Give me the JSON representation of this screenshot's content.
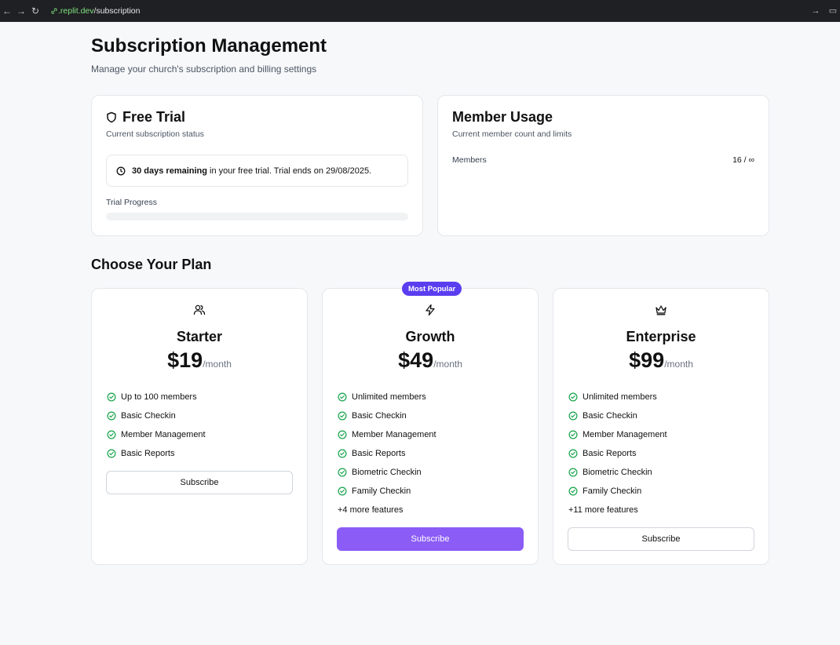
{
  "browser": {
    "url_host": ".replit.dev",
    "url_path": "/subscription"
  },
  "header": {
    "title": "Subscription Management",
    "subtitle": "Manage your church's subscription and billing settings"
  },
  "trial": {
    "title": "Free Trial",
    "subtitle": "Current subscription status",
    "alert_bold": "30 days remaining",
    "alert_text": " in your free trial. Trial ends on 29/08/2025.",
    "progress_label": "Trial Progress",
    "progress_fraction": 0
  },
  "usage": {
    "title": "Member Usage",
    "subtitle": "Current member count and limits",
    "members_label": "Members",
    "members_value": "16 / ∞"
  },
  "plans_section": {
    "title": "Choose Your Plan"
  },
  "plans": [
    {
      "name": "Starter",
      "icon": "users-icon",
      "price": "$19",
      "period": "/month",
      "features": [
        "Up to 100 members",
        "Basic Checkin",
        "Member Management",
        "Basic Reports"
      ],
      "more": "",
      "button": "Subscribe"
    },
    {
      "name": "Growth",
      "icon": "lightning-icon",
      "badge": "Most Popular",
      "price": "$49",
      "period": "/month",
      "features": [
        "Unlimited members",
        "Basic Checkin",
        "Member Management",
        "Basic Reports",
        "Biometric Checkin",
        "Family Checkin"
      ],
      "more": "+4 more features",
      "button": "Subscribe"
    },
    {
      "name": "Enterprise",
      "icon": "crown-icon",
      "price": "$99",
      "period": "/month",
      "features": [
        "Unlimited members",
        "Basic Checkin",
        "Member Management",
        "Basic Reports",
        "Biometric Checkin",
        "Family Checkin"
      ],
      "more": "+11 more features",
      "button": "Subscribe"
    }
  ],
  "colors": {
    "accent": "#8b5cf6",
    "badge": "#5b3df0",
    "check": "#16a34a"
  }
}
